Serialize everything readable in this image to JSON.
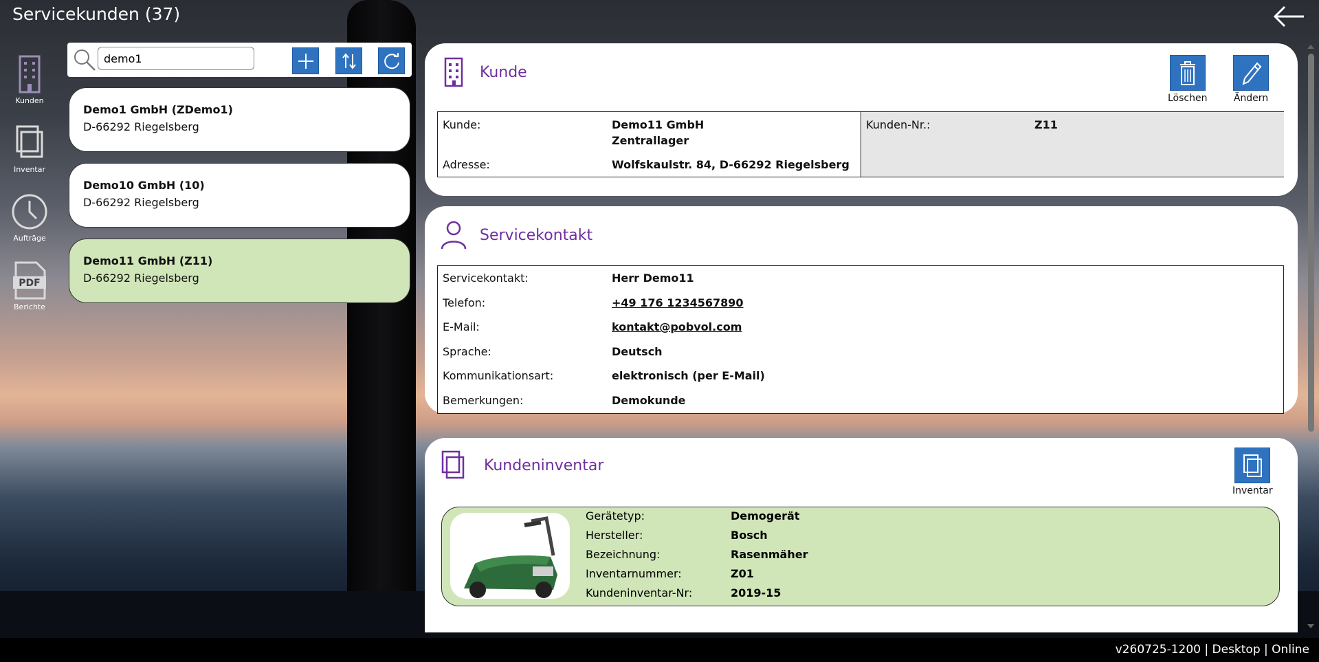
{
  "header": {
    "title": "Servicekunden (37)"
  },
  "nav": [
    {
      "label": "Kunden",
      "icon": "building-icon"
    },
    {
      "label": "Inventar",
      "icon": "copy-icon"
    },
    {
      "label": "Aufträge",
      "icon": "clock-icon"
    },
    {
      "label": "Berichte",
      "icon": "pdf-icon"
    }
  ],
  "search": {
    "value": "demo1"
  },
  "customers": [
    {
      "name": "Demo1 GmbH (ZDemo1)",
      "address": "D-66292 Riegelsberg"
    },
    {
      "name": "Demo10 GmbH (10)",
      "address": "D-66292 Riegelsberg"
    },
    {
      "name": "Demo11 GmbH (Z11)",
      "address": "D-66292 Riegelsberg"
    }
  ],
  "kunde": {
    "title": "Kunde",
    "delete_label": "Löschen",
    "edit_label": "Ändern",
    "customer_label": "Kunde:",
    "customer_value_line1": "Demo11 GmbH",
    "customer_value_line2": "Zentrallager",
    "address_label": "Adresse:",
    "address_value": "Wolfskaulstr. 84, D-66292 Riegelsberg",
    "number_label": "Kunden-Nr.:",
    "number_value": "Z11"
  },
  "contact": {
    "title": "Servicekontakt",
    "rows": [
      {
        "label": "Servicekontakt:",
        "value": "Herr Demo11"
      },
      {
        "label": "Telefon:",
        "value": "+49 176 1234567890"
      },
      {
        "label": "E-Mail:",
        "value": "kontakt@pobvol.com"
      },
      {
        "label": "Sprache:",
        "value": "Deutsch"
      },
      {
        "label": "Kommunikationsart:",
        "value": "elektronisch (per E-Mail)"
      },
      {
        "label": "Bemerkungen:",
        "value": "Demokunde"
      }
    ]
  },
  "inventory": {
    "title": "Kundeninventar",
    "button_label": "Inventar",
    "rows": [
      {
        "label": "Gerätetyp:",
        "value": "Demogerät"
      },
      {
        "label": "Hersteller:",
        "value": "Bosch"
      },
      {
        "label": "Bezeichnung:",
        "value": "Rasenmäher"
      },
      {
        "label": "Inventarnummer:",
        "value": "Z01"
      },
      {
        "label": "Kundeninventar-Nr:",
        "value": "2019-15"
      }
    ]
  },
  "footer": {
    "status": "v260725-1200 | Desktop | Online"
  },
  "colors": {
    "accent": "#2f73c0",
    "title_purple": "#6f2f9f",
    "selected_green": "#d0e6b8"
  }
}
